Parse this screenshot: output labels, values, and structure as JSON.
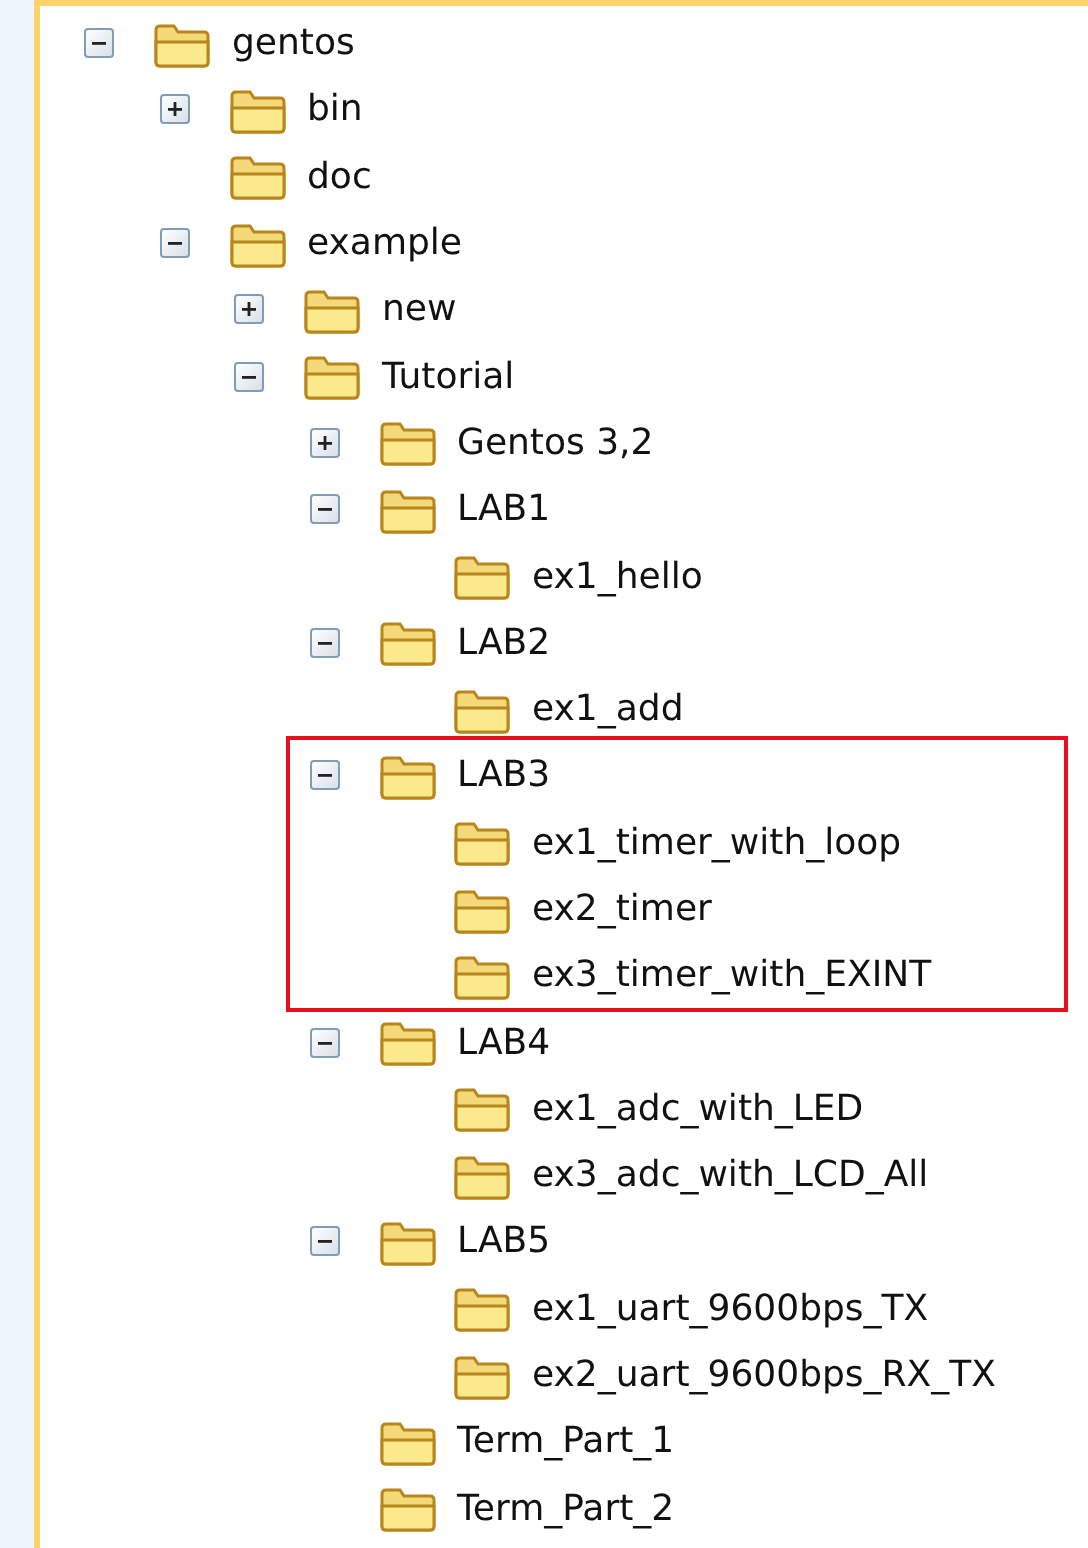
{
  "tree": [
    {
      "label": "gentos",
      "expanded": true,
      "children": [
        {
          "label": "bin",
          "expanded": false
        },
        {
          "label": "doc"
        },
        {
          "label": "example",
          "expanded": true,
          "children": [
            {
              "label": "new",
              "expanded": false
            },
            {
              "label": "Tutorial",
              "expanded": true,
              "children": [
                {
                  "label": "Gentos 3,2",
                  "expanded": false
                },
                {
                  "label": "LAB1",
                  "expanded": true,
                  "children": [
                    {
                      "label": "ex1_hello"
                    }
                  ]
                },
                {
                  "label": "LAB2",
                  "expanded": true,
                  "children": [
                    {
                      "label": "ex1_add"
                    }
                  ]
                },
                {
                  "label": "LAB3",
                  "expanded": true,
                  "highlighted": true,
                  "children": [
                    {
                      "label": "ex1_timer_with_loop"
                    },
                    {
                      "label": "ex2_timer"
                    },
                    {
                      "label": "ex3_timer_with_EXINT"
                    }
                  ]
                },
                {
                  "label": "LAB4",
                  "expanded": true,
                  "children": [
                    {
                      "label": "ex1_adc_with_LED"
                    },
                    {
                      "label": "ex3_adc_with_LCD_All"
                    }
                  ]
                },
                {
                  "label": "LAB5",
                  "expanded": true,
                  "children": [
                    {
                      "label": "ex1_uart_9600bps_TX"
                    },
                    {
                      "label": "ex2_uart_9600bps_RX_TX"
                    }
                  ]
                },
                {
                  "label": "Term_Part_1"
                },
                {
                  "label": "Term_Part_2"
                }
              ]
            }
          ]
        }
      ]
    }
  ]
}
